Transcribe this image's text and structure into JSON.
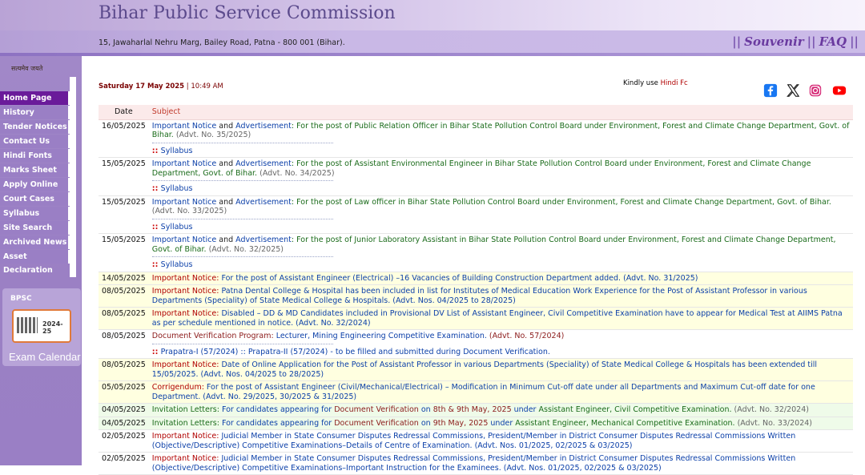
{
  "header": {
    "title": "Bihar Public Service Commission",
    "address": "15, Jawaharlal Nehru Marg, Bailey Road, Patna - 800 001 (Bihar).",
    "quick_links": [
      "Souvenir",
      "FAQ"
    ],
    "motto": "सत्यमेव जयते"
  },
  "sidebar": {
    "items": [
      {
        "label": "Home Page",
        "active": true
      },
      {
        "label": "History"
      },
      {
        "label": "Tender Notices"
      },
      {
        "label": "Contact Us"
      },
      {
        "label": "Hindi Fonts"
      },
      {
        "label": "Marks Sheet"
      },
      {
        "label": "Apply Online"
      },
      {
        "label": "Court Cases"
      },
      {
        "label": "Syllabus"
      },
      {
        "label": "Site Search"
      },
      {
        "label": "Archived News"
      },
      {
        "label": "Asset Declaration"
      }
    ],
    "exam_calendar": {
      "brand": "BPSC",
      "year": "2024-25",
      "label": "Exam Calendar"
    }
  },
  "topbar": {
    "date": "Saturday 17 May 2025",
    "time": "10:49 AM",
    "kindly_prefix": "Kindly use",
    "kindly_link": "Hindi Fc"
  },
  "social": [
    "facebook-icon",
    "x-icon",
    "instagram-icon",
    "youtube-icon"
  ],
  "colors": {
    "sidebar": "#9a7fc5",
    "active_nav": "#6a1b9a",
    "title": "#5b4a8c",
    "quick_link": "#6a3aa0"
  },
  "table": {
    "headers": {
      "date": "Date",
      "subject": "Subject"
    },
    "rows": [
      {
        "date": "16/05/2025",
        "style": "w",
        "parts": [
          [
            "Important Notice",
            "lnk"
          ],
          [
            " and ",
            ""
          ],
          [
            "Advertisement",
            "lnk"
          ],
          [
            ": For the post of Public Relation Officer in Bihar State Pollution Control Board under Environment, Forest and Climate Change Department, Govt. of Bihar.",
            "grn"
          ],
          [
            " (Advt. No. 35/2025)",
            "gry"
          ]
        ],
        "sub": "Syllabus"
      },
      {
        "date": "15/05/2025",
        "style": "w",
        "parts": [
          [
            "Important Notice",
            "lnk"
          ],
          [
            " and ",
            ""
          ],
          [
            "Advertisement",
            "lnk"
          ],
          [
            ": For the post of Assistant Environmental Engineer in Bihar State Pollution Control Board under Environment, Forest and Climate Change Department, Govt. of Bihar.",
            "grn"
          ],
          [
            " (Advt. No. 34/2025)",
            "gry"
          ]
        ],
        "sub": "Syllabus"
      },
      {
        "date": "15/05/2025",
        "style": "w",
        "parts": [
          [
            "Important Notice",
            "lnk"
          ],
          [
            " and ",
            ""
          ],
          [
            "Advertisement",
            "lnk"
          ],
          [
            ": For the post of Law officer in Bihar State Pollution Control Board under Environment, Forest and Climate Change Department, Govt. of Bihar.",
            "grn"
          ],
          [
            " (Advt. No. 33/2025)",
            "gry"
          ]
        ],
        "sub": "Syllabus"
      },
      {
        "date": "15/05/2025",
        "style": "w",
        "parts": [
          [
            "Important Notice",
            "lnk"
          ],
          [
            " and ",
            ""
          ],
          [
            "Advertisement",
            "lnk"
          ],
          [
            ": For the post of Junior Laboratory Assistant in Bihar State Pollution Control Board under Environment, Forest and Climate Change Department, Govt. of Bihar.",
            "grn"
          ],
          [
            " (Advt. No. 32/2025)",
            "gry"
          ]
        ],
        "sub": "Syllabus"
      },
      {
        "date": "14/05/2025",
        "style": "y",
        "parts": [
          [
            "Important Notice: ",
            "red"
          ],
          [
            "For the post of Assistant Engineer (Electrical) –16 Vacancies of Building Construction Department added. (Advt. No. 31/2025)",
            "lnk"
          ]
        ]
      },
      {
        "date": "08/05/2025",
        "style": "y",
        "parts": [
          [
            "Important Notice: ",
            "red"
          ],
          [
            "Patna Dental College & Hospital has been included in list for Institutes of Medical Education Work Experience for the Post of Assistant Professor in various Departments (Speciality) of State Medical College & Hospitals. (Advt. Nos. 04/2025 to 28/2025)",
            "lnk"
          ]
        ]
      },
      {
        "date": "08/05/2025",
        "style": "y",
        "parts": [
          [
            "Important Notice: ",
            "red"
          ],
          [
            "Disabled – DD & MD Candidates included in Provisional DV List of Assistant Engineer, Civil Competitive Examination have to appear for Medical Test at AIIMS Patna as per schedule mentioned in notice. (Advt. No. 32/2024)",
            "lnk"
          ]
        ]
      },
      {
        "date": "08/05/2025",
        "style": "w",
        "parts": [
          [
            "Document Verification Program: ",
            "mar"
          ],
          [
            "Lecturer, Mining Engineering Competitive Examination.",
            "lnk"
          ],
          [
            " (Advt. No. 57/2024)",
            "mar"
          ]
        ],
        "sub": "Prapatra-I (57/2024) :: Prapatra-II (57/2024) - to be filled and submitted during Document Verification."
      },
      {
        "date": "08/05/2025",
        "style": "y",
        "parts": [
          [
            "Important Notice: ",
            "red"
          ],
          [
            "Date of Online Application for the Post of Assistant Professor in various Departments (Speciality) of State Medical College & Hospitals has been extended till 15/05/2025. (Advt. Nos. 04/2025 to 28/2025)",
            "lnk"
          ]
        ]
      },
      {
        "date": "05/05/2025",
        "style": "y",
        "parts": [
          [
            "Corrigendum: ",
            "red"
          ],
          [
            "For the post of Assistant Engineer (Civil/Mechanical/Electrical) – Modification in Minimum Cut-off date under all Departments and Maximum Cut-off date for one Department. (Advt. No. 29/2025, 30/2025 & 31/2025)",
            "lnk"
          ]
        ]
      },
      {
        "date": "04/05/2025",
        "style": "g",
        "parts": [
          [
            "Invitation Letters: ",
            "grn"
          ],
          [
            "For candidates appearing for ",
            "lnk"
          ],
          [
            "Document Verification",
            "mar"
          ],
          [
            " on ",
            "lnk"
          ],
          [
            "8th & 9th May, 2025",
            "mar"
          ],
          [
            " under ",
            "lnk"
          ],
          [
            "Assistant Engineer, Civil Competitive Examination.",
            "grn"
          ],
          [
            " (Advt. No. 32/2024)",
            "gry"
          ]
        ]
      },
      {
        "date": "04/05/2025",
        "style": "g",
        "parts": [
          [
            "Invitation Letters: ",
            "grn"
          ],
          [
            "For candidates appearing for ",
            "lnk"
          ],
          [
            "Document Verification",
            "mar"
          ],
          [
            " on ",
            "lnk"
          ],
          [
            "9th May, 2025",
            "mar"
          ],
          [
            " under ",
            "lnk"
          ],
          [
            "Assistant Engineer, Mechanical Competitive Examination.",
            "grn"
          ],
          [
            " (Advt. No. 33/2024)",
            "gry"
          ]
        ]
      },
      {
        "date": "02/05/2025",
        "style": "w",
        "parts": [
          [
            "Important Notice: ",
            "red"
          ],
          [
            "Judicial Member in State Consumer Disputes Redressal Commissions, President/Member in District Consumer Disputes Redressal Commissions Written (Objective/Descriptive) Competitive Examinations–Details of Centre of Examination. (Advt. Nos. 01/2025, 02/2025 & 03/2025)",
            "lnk"
          ]
        ]
      },
      {
        "date": "02/05/2025",
        "style": "w",
        "parts": [
          [
            "Important Notice: ",
            "red"
          ],
          [
            "Judicial Member in State Consumer Disputes Redressal Commissions, President/Member in District Consumer Disputes Redressal Commissions Written (Objective/Descriptive) Competitive Examinations–Important Instruction for the Examinees. (Advt. Nos. 01/2025, 02/2025 & 03/2025)",
            "lnk"
          ]
        ]
      }
    ]
  }
}
